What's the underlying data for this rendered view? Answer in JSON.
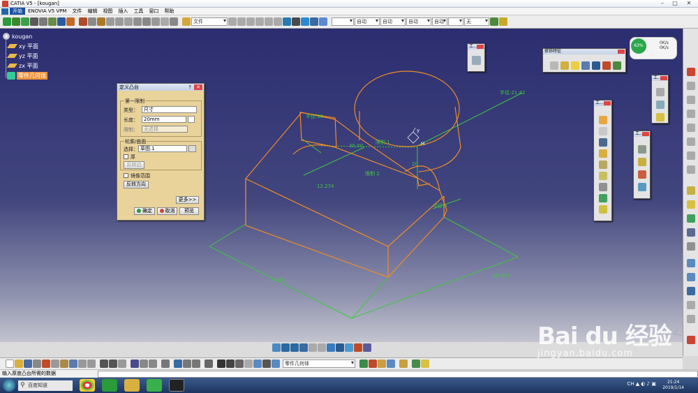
{
  "window": {
    "title": "CATIA V5 - [kougan]"
  },
  "window_controls": {
    "minimize": "–",
    "maximize": "□",
    "close": "✕"
  },
  "menu": [
    "开始",
    "ENOVIA V5 VPM",
    "文件",
    "编辑",
    "视图",
    "插入",
    "工具",
    "窗口",
    "帮助"
  ],
  "toolbar": {
    "file_combo": "文件",
    "line_combo_1": "自动",
    "line_combo_2": "自动",
    "line_combo_3": "自动",
    "layer_combo": "自动",
    "layer2_combo": "无"
  },
  "tree": {
    "root": "kougan",
    "items": [
      "xy 平面",
      "yz 平面",
      "zx 平面"
    ],
    "body": "零件几何体"
  },
  "dialog": {
    "title": "定义凸台",
    "help": "?",
    "close": "✕",
    "group1_title": "第一限制",
    "type_label": "类型：",
    "type_value": "尺寸",
    "length_label": "长度：",
    "length_value": "20mm",
    "limit_label": "限制：",
    "limit_value": "无选择",
    "group2_title": "轮廓/曲面",
    "selection_label": "选择：",
    "selection_value": "草图.1",
    "thick_label": "厚",
    "reverse_side": "反转边",
    "mirror_label": "镜像范围",
    "reverse_dir": "反转方向",
    "more": "更多>>",
    "ok": "确定",
    "cancel": "取消",
    "preview": "预览"
  },
  "floating": {
    "feature_tb_title": "修饰特征",
    "tb_small": "工...",
    "tb_tall": "工...",
    "tb_mid": "工..."
  },
  "compass": {
    "percent": "63%",
    "line1": "0K/s",
    "line2": "0K/s"
  },
  "model_labels": {
    "radius_top": "半径:21.42",
    "radius_left": "半径:10",
    "radius_right": "半径:5",
    "dim_12274": "12.274",
    "dim_35": "35.00",
    "dim_20": "20",
    "limit1": "限制 1",
    "limit2": "限制 2",
    "dim_bottom_left": "51.66",
    "dim_bottom_right": "36.333",
    "axis_y": "y",
    "axis_h": "H"
  },
  "bottom_toolbar": {
    "body_combo": "零件几何体"
  },
  "status": {
    "text": "输入厚度凸台所需的数据"
  },
  "taskbar": {
    "search": "百度知道",
    "lang": "CH",
    "time": "21:24",
    "date": "2019/1/14"
  },
  "watermark": {
    "brand": "Bai du 经验",
    "url": "jingyan.baidu.com"
  }
}
